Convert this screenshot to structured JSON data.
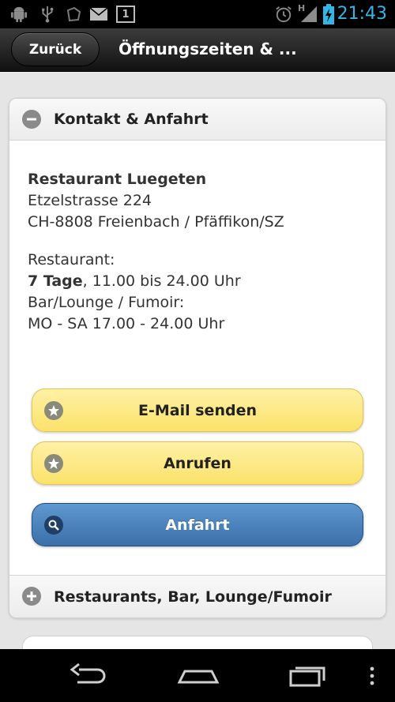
{
  "status_bar": {
    "time": "21:43",
    "network_type": "H",
    "icons": [
      "android-debug-icon",
      "usb-icon",
      "app-icon",
      "mail-icon",
      "notification-count-icon",
      "alarm-icon",
      "signal-icon",
      "battery-charging-icon"
    ],
    "notification_count": "1"
  },
  "header": {
    "back_label": "Zurück",
    "title": "Öffnungszeiten & ..."
  },
  "contact_section": {
    "label": "Kontakt & Anfahrt",
    "expanded": true,
    "address": {
      "name": "Restaurant Luegeten",
      "street": "Etzelstrasse 224",
      "city": "CH-8808 Freienbach / Pfäffikon/SZ"
    },
    "hours": {
      "restaurant_label": "Restaurant:",
      "restaurant_days": "7 Tage",
      "restaurant_time": ", 11.00 bis 24.00 Uhr",
      "bar_label": "Bar/Lounge / Fumoir:",
      "bar_time": "MO - SA 17.00 - 24.00 Uhr"
    },
    "buttons": {
      "email": "E-Mail senden",
      "call": "Anrufen",
      "directions": "Anfahrt"
    }
  },
  "restaurants_section": {
    "label": "Restaurants, Bar, Lounge/Fumoir",
    "expanded": false
  },
  "colors": {
    "accent_time": "#33b5e5",
    "button_yellow": "#fbe26a",
    "button_blue": "#3b6fa8"
  }
}
